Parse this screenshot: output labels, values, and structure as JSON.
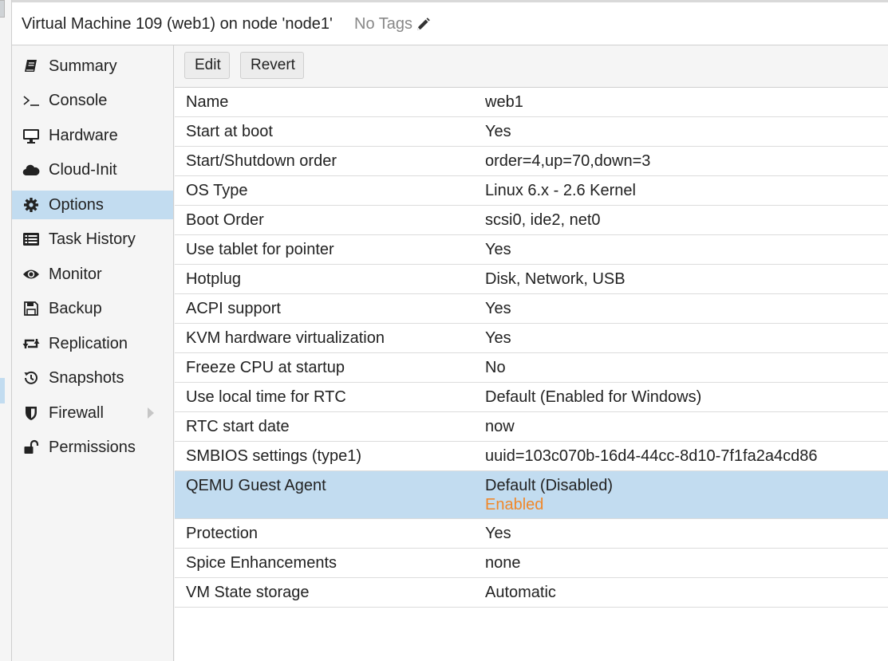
{
  "header": {
    "title": "Virtual Machine 109 (web1) on node 'node1'",
    "tags": "No Tags",
    "edit_tags_icon": "pencil-icon"
  },
  "nav": {
    "items": [
      {
        "label": "Summary",
        "icon": "book-icon"
      },
      {
        "label": "Console",
        "icon": "terminal-icon"
      },
      {
        "label": "Hardware",
        "icon": "monitor-icon"
      },
      {
        "label": "Cloud-Init",
        "icon": "cloud-icon"
      },
      {
        "label": "Options",
        "icon": "gear-icon",
        "active": true
      },
      {
        "label": "Task History",
        "icon": "list-icon"
      },
      {
        "label": "Monitor",
        "icon": "eye-icon"
      },
      {
        "label": "Backup",
        "icon": "floppy-icon"
      },
      {
        "label": "Replication",
        "icon": "retweet-icon"
      },
      {
        "label": "Snapshots",
        "icon": "history-icon"
      },
      {
        "label": "Firewall",
        "icon": "shield-icon",
        "expandable": true
      },
      {
        "label": "Permissions",
        "icon": "unlock-icon"
      }
    ],
    "active_color": "#c2dcf0"
  },
  "toolbar": {
    "edit_label": "Edit",
    "revert_label": "Revert"
  },
  "options": [
    {
      "name": "Name",
      "value": "web1"
    },
    {
      "name": "Start at boot",
      "value": "Yes"
    },
    {
      "name": "Start/Shutdown order",
      "value": "order=4,up=70,down=3"
    },
    {
      "name": "OS Type",
      "value": "Linux 6.x - 2.6 Kernel"
    },
    {
      "name": "Boot Order",
      "value": "scsi0, ide2, net0"
    },
    {
      "name": "Use tablet for pointer",
      "value": "Yes"
    },
    {
      "name": "Hotplug",
      "value": "Disk, Network, USB"
    },
    {
      "name": "ACPI support",
      "value": "Yes"
    },
    {
      "name": "KVM hardware virtualization",
      "value": "Yes"
    },
    {
      "name": "Freeze CPU at startup",
      "value": "No"
    },
    {
      "name": "Use local time for RTC",
      "value": "Default (Enabled for Windows)"
    },
    {
      "name": "RTC start date",
      "value": "now"
    },
    {
      "name": "SMBIOS settings (type1)",
      "value": "uuid=103c070b-16d4-44cc-8d10-7f1fa2a4cd86"
    },
    {
      "name": "QEMU Guest Agent",
      "value": "Default (Disabled)",
      "pending": "Enabled",
      "selected": true
    },
    {
      "name": "Protection",
      "value": "Yes"
    },
    {
      "name": "Spice Enhancements",
      "value": "none"
    },
    {
      "name": "VM State storage",
      "value": "Automatic"
    }
  ],
  "colors": {
    "selected_row": "#c2dcf0",
    "pending_value": "#f0882a"
  }
}
